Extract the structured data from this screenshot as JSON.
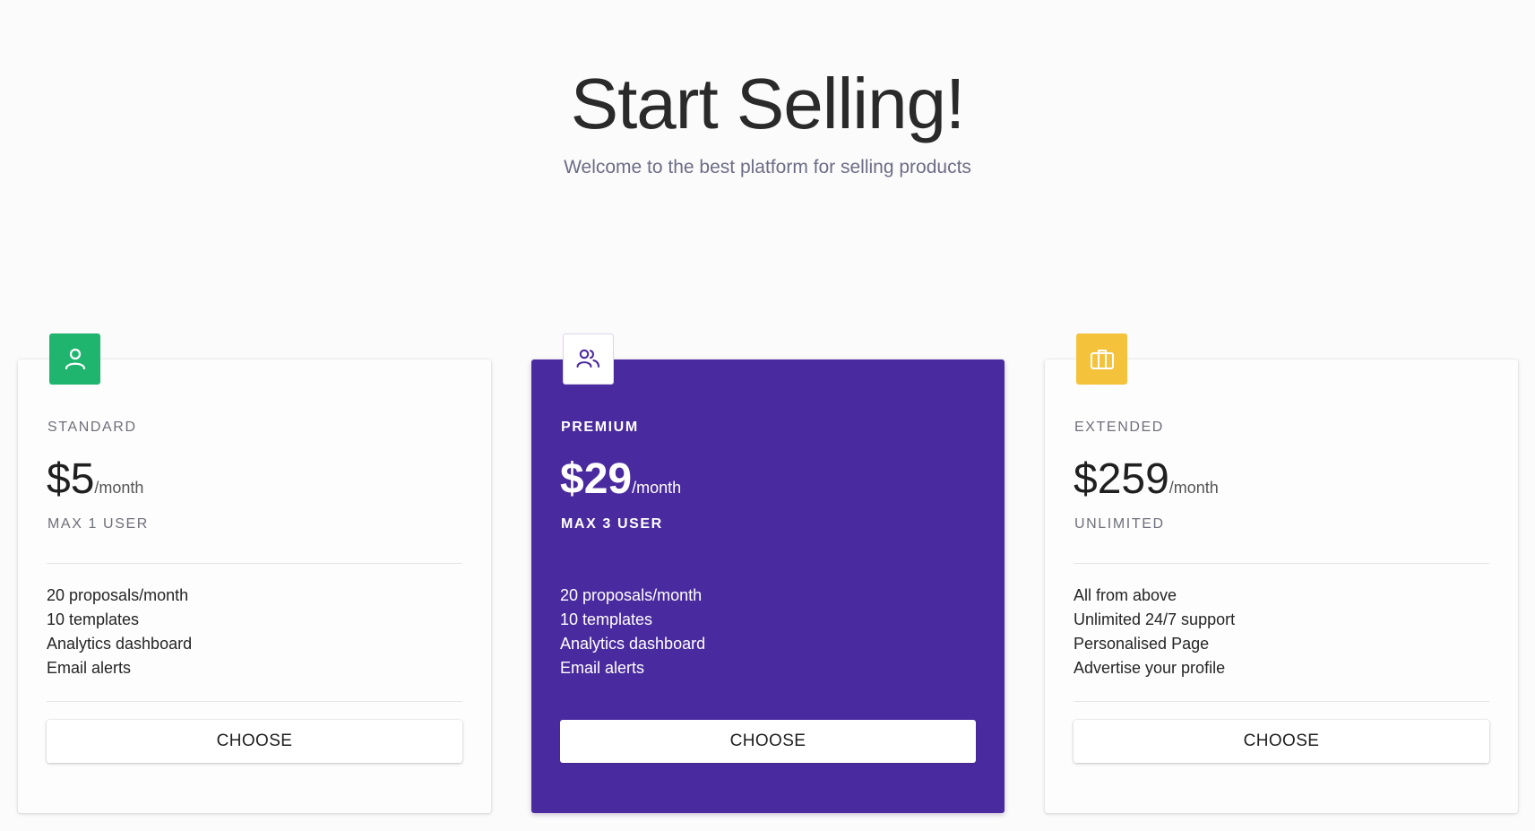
{
  "hero": {
    "title": "Start Selling!",
    "subtitle": "Welcome to the best platform for selling products"
  },
  "plans": [
    {
      "name": "STANDARD",
      "price": "$5",
      "period": "/month",
      "limit": "MAX 1 USER",
      "icon": "user-icon",
      "accent": "#20b56f",
      "features": [
        "20 proposals/month",
        "10 templates",
        "Analytics dashboard",
        "Email alerts"
      ],
      "button": "CHOOSE"
    },
    {
      "name": "PREMIUM",
      "price": "$29",
      "period": "/month",
      "limit": "MAX 3 USER",
      "icon": "users-icon",
      "accent": "#4a2b9f",
      "features": [
        "20 proposals/month",
        "10 templates",
        "Analytics dashboard",
        "Email alerts"
      ],
      "button": "CHOOSE"
    },
    {
      "name": "EXTENDED",
      "price": "$259",
      "period": "/month",
      "limit": "UNLIMITED",
      "icon": "briefcase-icon",
      "accent": "#f5c23c",
      "features": [
        "All from above",
        "Unlimited 24/7 support",
        "Personalised Page",
        "Advertise your profile"
      ],
      "button": "CHOOSE"
    }
  ]
}
